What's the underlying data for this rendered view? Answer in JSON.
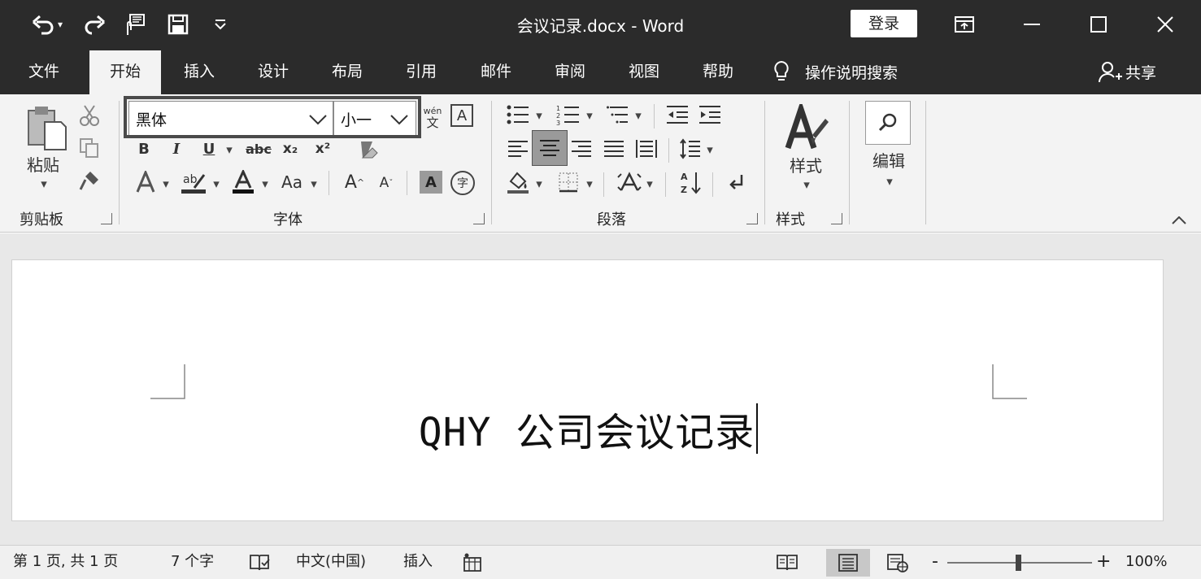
{
  "titlebar": {
    "doc_title": "会议记录.docx  -  Word",
    "login_label": "登录"
  },
  "menubar": {
    "tabs": [
      {
        "label": "文件"
      },
      {
        "label": "开始"
      },
      {
        "label": "插入"
      },
      {
        "label": "设计"
      },
      {
        "label": "布局"
      },
      {
        "label": "引用"
      },
      {
        "label": "邮件"
      },
      {
        "label": "审阅"
      },
      {
        "label": "视图"
      },
      {
        "label": "帮助"
      }
    ],
    "active_tab": "开始",
    "tell_me": "操作说明搜索",
    "share": "共享"
  },
  "ribbon": {
    "clipboard": {
      "paste_label": "粘贴",
      "group_label": "剪贴板"
    },
    "font": {
      "font_name": "黑体",
      "font_size": "小一",
      "group_label": "字体",
      "bold": "B",
      "italic": "I",
      "underline": "U",
      "strike": "abc",
      "subscript": "x₂",
      "superscript": "x²",
      "wen": "wén",
      "wen_char": "文",
      "border_char": "A",
      "case": "Aa",
      "grow": "A",
      "shrink": "A",
      "shade_char": "A",
      "enclose": "字"
    },
    "paragraph": {
      "group_label": "段落",
      "active_align": "center"
    },
    "styles": {
      "label": "样式",
      "group_label": "样式"
    },
    "editing": {
      "label": "编辑"
    }
  },
  "document": {
    "heading": "QHY 公司会议记录"
  },
  "statusbar": {
    "page": "第 1 页, 共 1 页",
    "words": "7 个字",
    "language": "中文(中国)",
    "mode": "插入",
    "zoom": "100%",
    "zoom_minus": "-",
    "zoom_plus": "+",
    "zoom_fraction": 0.5
  },
  "colors": {
    "titlebar_bg": "#2b2b2b",
    "ribbon_bg": "#f3f3f3",
    "doc_bg": "#e8e8e8"
  }
}
